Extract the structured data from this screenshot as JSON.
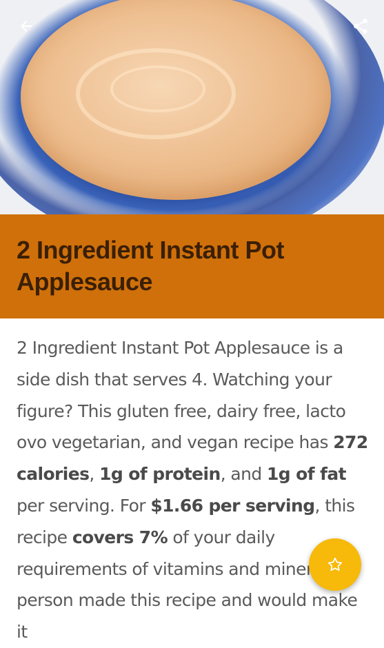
{
  "recipe": {
    "title": "2 Ingredient Instant Pot Applesauce"
  },
  "description": {
    "p1": "2 Ingredient Instant Pot Applesauce is a side dish that serves 4. Watching your figure? This gluten free, dairy free, lacto ovo vegetarian, and vegan recipe has ",
    "calories": "272 calories",
    "p2": ", ",
    "protein": "1g of protein",
    "p3": ", and ",
    "fat": "1g of fat",
    "p4": " per serving. For ",
    "price": "$1.66 per serving",
    "p5": ", this recipe ",
    "covers": "covers 7%",
    "p6": " of your daily requirements of vitamins and minerals. 1 person made this recipe and would make it"
  },
  "icons": {
    "back": "back-arrow-icon",
    "share": "share-icon",
    "favorite": "star-outline-icon"
  },
  "colors": {
    "title_bar": "#d0700a",
    "title_text": "#3a1f05",
    "fab": "#f7b90a"
  }
}
